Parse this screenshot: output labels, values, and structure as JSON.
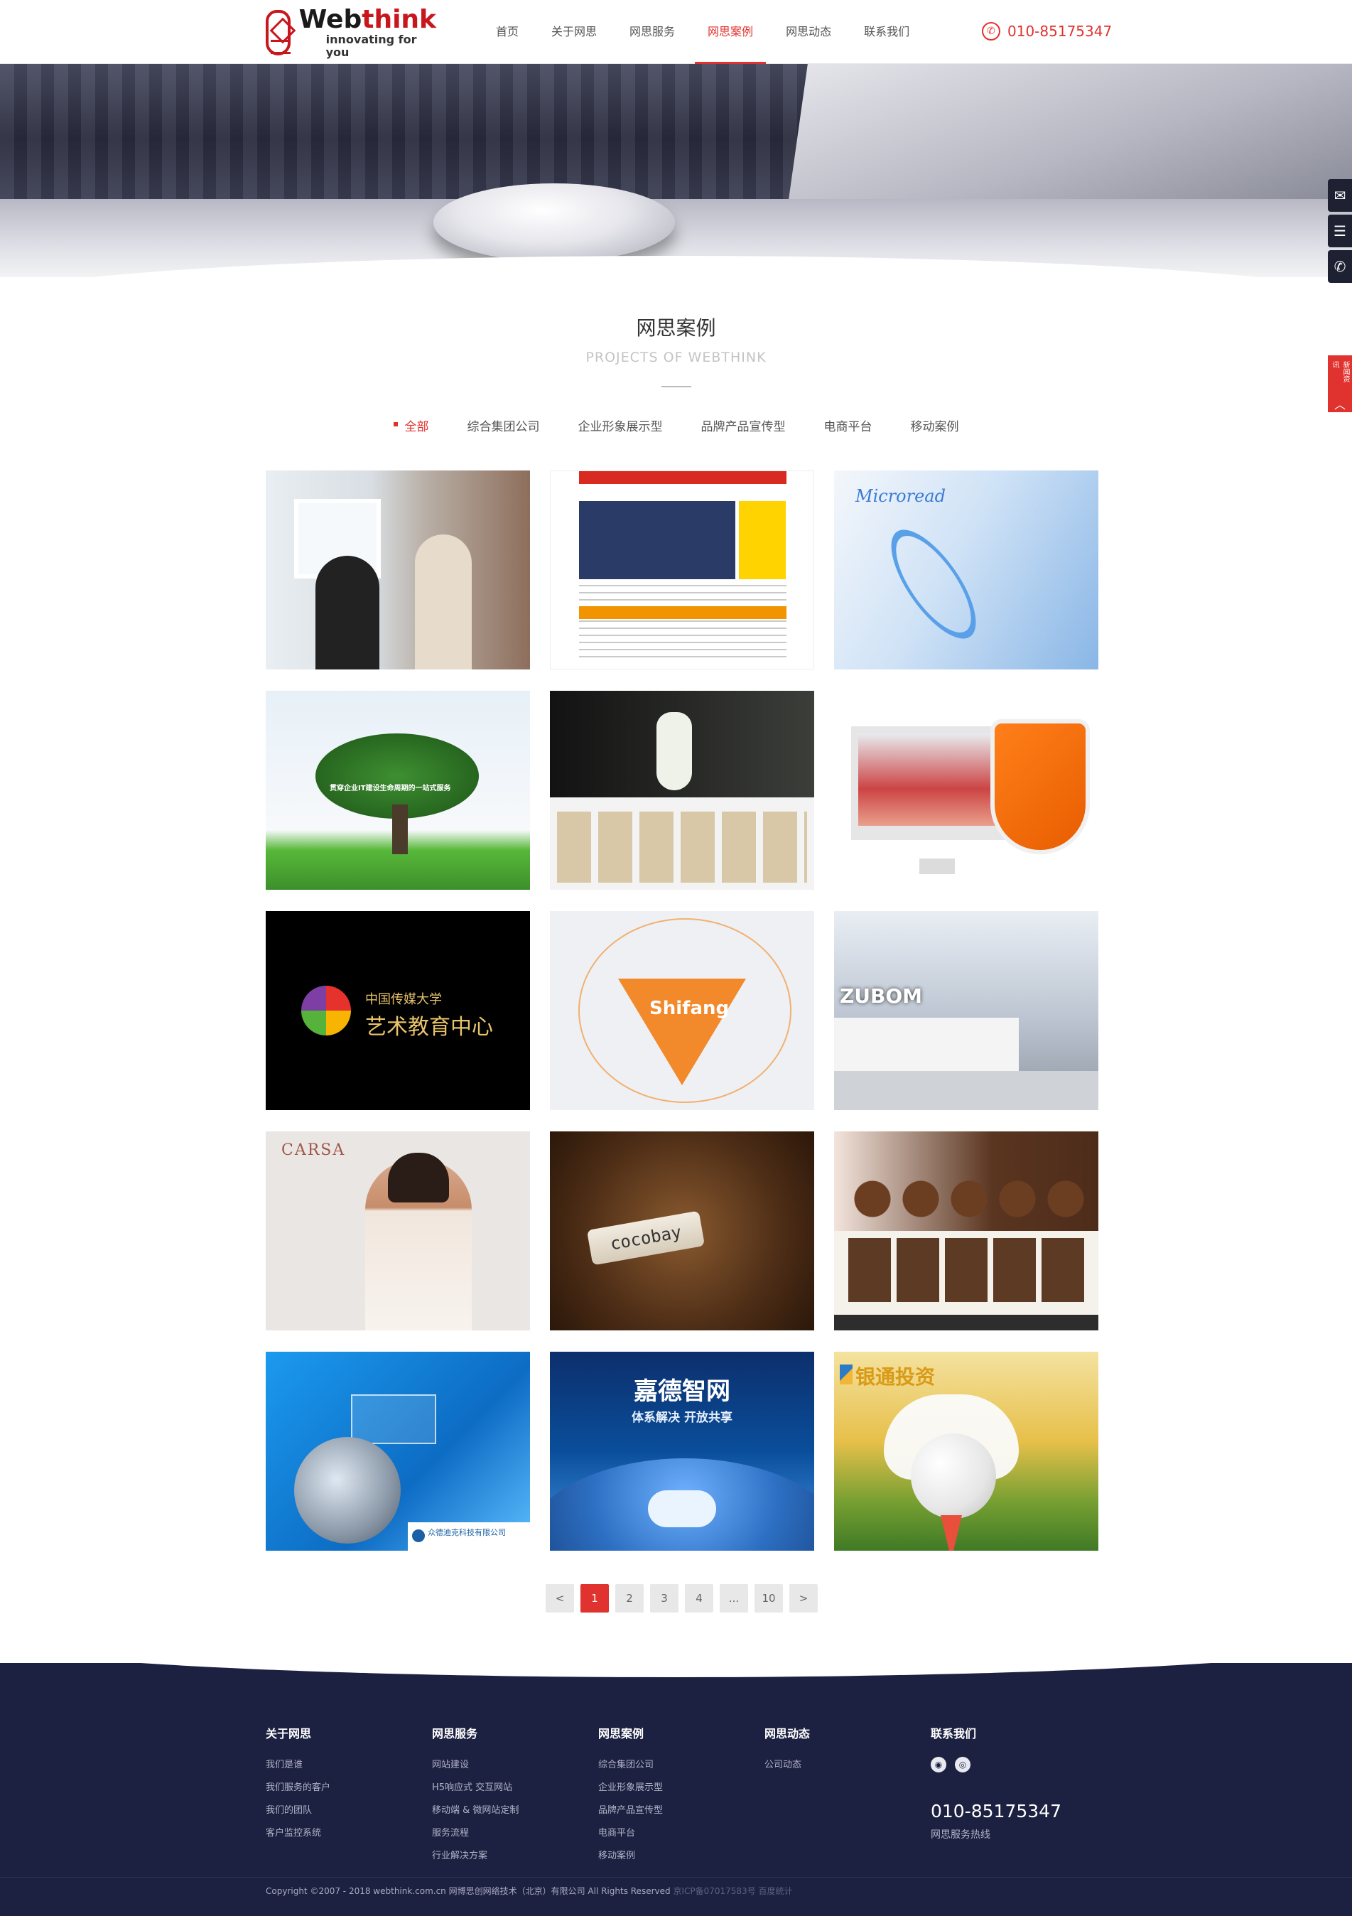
{
  "header": {
    "logo": {
      "brand_prefix": "Web",
      "brand_suffix": "think",
      "tagline": "innovating for you"
    },
    "nav": [
      "首页",
      "关于网思",
      "网思服务",
      "网思案例",
      "网思动态",
      "联系我们"
    ],
    "active_nav": "网思案例",
    "phone": "010-85175347"
  },
  "side_tools": {
    "red_label": "新闻资讯",
    "up_arrow": "︿"
  },
  "section": {
    "title": "网思案例",
    "subtitle": "PROJECTS OF WEBTHINK"
  },
  "filters": [
    "全部",
    "综合集团公司",
    "企业形象展示型",
    "品牌产品宣传型",
    "电商平台",
    "移动案例"
  ],
  "active_filter": "全部",
  "cases": {
    "c3_brand": "Microread",
    "c4_text": "贯穿企业IT建设生命周期的一站式服务",
    "c7_t1": "中国传媒大学",
    "c7_t2": "艺术教育中心",
    "c8_text": "Shifang",
    "c9_logo": "ZUBOM",
    "c10_brand": "CARSA",
    "c11_tag": "cocobay",
    "c13_footer": "众德迪克科技有限公司",
    "c14_t1": "嘉德智网",
    "c14_t2": "体系解决 开放共享",
    "c15_brand": "银通投资"
  },
  "pagination": [
    "<",
    "1",
    "2",
    "3",
    "4",
    "...",
    "10",
    ">"
  ],
  "active_page": "1",
  "footer": {
    "col_about": {
      "title": "关于网思",
      "items": [
        "我们是谁",
        "我们服务的客户",
        "我们的团队",
        "客户监控系统"
      ]
    },
    "col_service": {
      "title": "网思服务",
      "items": [
        "网站建设",
        "H5响应式 交互网站",
        "移动端 & 微网站定制",
        "服务流程",
        "行业解决方案"
      ]
    },
    "col_cases": {
      "title": "网思案例",
      "items": [
        "综合集团公司",
        "企业形象展示型",
        "品牌产品宣传型",
        "电商平台",
        "移动案例"
      ]
    },
    "col_news": {
      "title": "网思动态",
      "items": [
        "公司动态"
      ]
    },
    "col_contact": {
      "title": "联系我们",
      "phone": "010-85175347",
      "phone_label": "网思服务热线"
    },
    "copyright": "Copyright ©2007 - 2018 webthink.com.cn 网博思创网络技术（北京）有限公司 All Rights Reserved",
    "icp": "京ICP备07017583号 百度统计"
  },
  "colors": {
    "accent": "#e0322e",
    "footer_bg": "#1d2141",
    "text": "#333333"
  }
}
